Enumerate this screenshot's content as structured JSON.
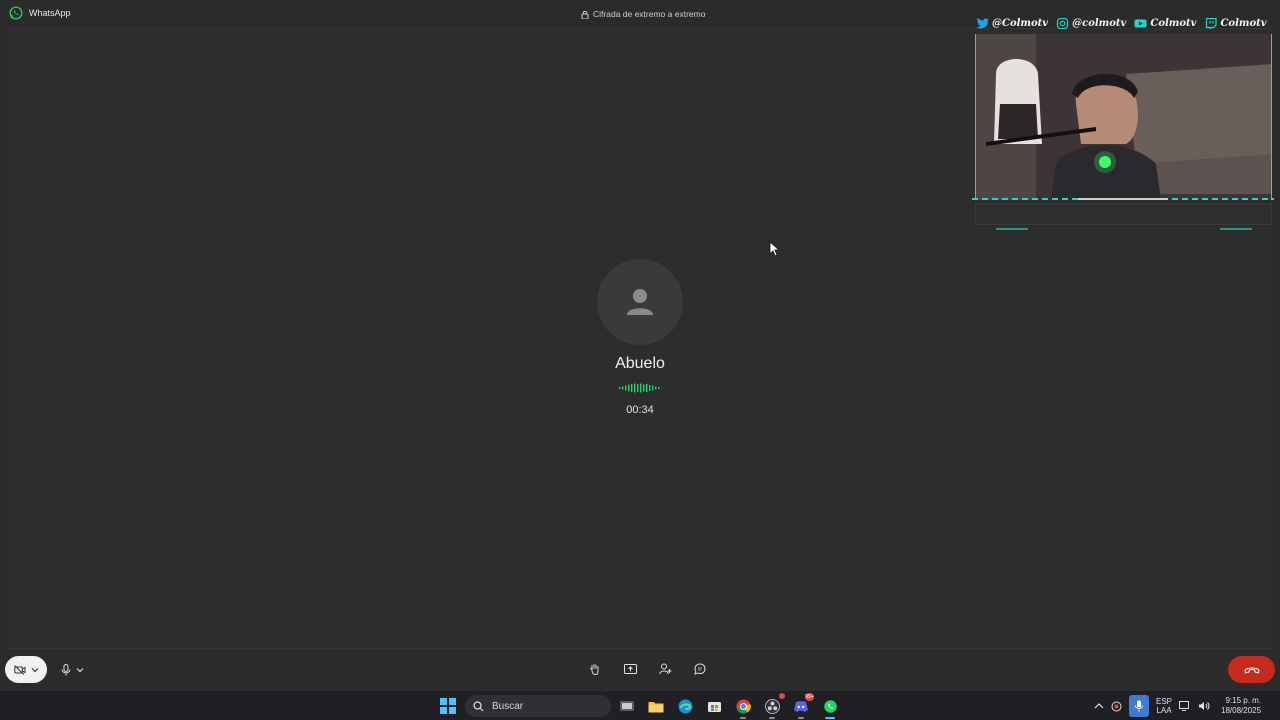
{
  "window": {
    "app_name": "WhatsApp",
    "encryption_notice": "Cifrada de extremo a extremo"
  },
  "call": {
    "contact_name": "Abuelo",
    "duration": "00:34"
  },
  "overlay": {
    "socials": [
      {
        "platform": "twitter",
        "handle": "@Colmotv"
      },
      {
        "platform": "instagram",
        "handle": "@colmotv"
      },
      {
        "platform": "youtube",
        "handle": "Colmotv"
      },
      {
        "platform": "twitch",
        "handle": "Colmotv"
      }
    ],
    "accent_color": "#2ad3c7"
  },
  "controls": {
    "camera_icon": "camera-off-icon",
    "mic_icon": "microphone-icon",
    "center_icons": [
      "raise-hand-icon",
      "share-screen-icon",
      "add-person-icon",
      "chat-icon"
    ],
    "hangup_icon": "end-call-icon",
    "hangup_color": "#c42b1c"
  },
  "taskbar": {
    "search_placeholder": "Buscar",
    "language_line1": "ESP",
    "language_line2": "LAA",
    "time": "9:15 p. m.",
    "date": "18/08/2025",
    "discord_badge": "99+"
  }
}
